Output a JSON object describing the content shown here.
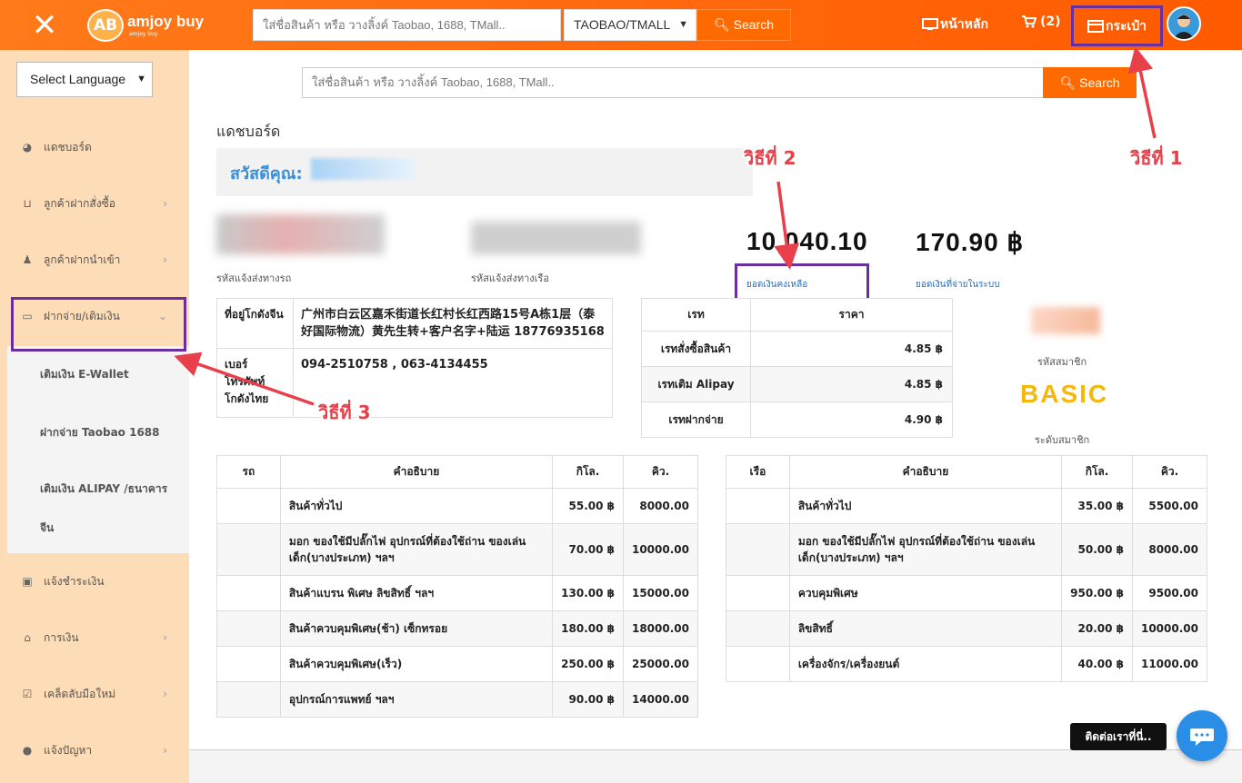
{
  "topbar": {
    "close_icon": "✕",
    "logo_mark": "AB",
    "logo_text": "amjoy buy",
    "logo_sub": "amjoy buy",
    "search_placeholder": "ใส่ชื่อสินค้า หรือ วางลิ้งค์ Taobao, 1688, TMall..",
    "source_select": "TAOBAO/TMALL",
    "search_label": "Search",
    "home_label": "หน้าหลัก",
    "cart_label": "(2)",
    "wallet_label": "กระเป๋า"
  },
  "sidebar": {
    "language_select": "Select Language",
    "items": [
      {
        "label": "แดชบอร์ด",
        "icon": "dashboard-icon"
      },
      {
        "label": "ลูกค้าฝากสั่งซื้อ",
        "icon": "basket-icon"
      },
      {
        "label": "ลูกค้าฝากนำเข้า",
        "icon": "import-icon"
      },
      {
        "label": "ฝากจ่าย/เติมเงิน",
        "icon": "card-icon"
      },
      {
        "label": "แจ้งชำระเงิน",
        "icon": "money-icon"
      },
      {
        "label": "การเงิน",
        "icon": "bank-icon"
      },
      {
        "label": "เคล็ดลับมือใหม่",
        "icon": "check-icon"
      },
      {
        "label": "แจ้งปัญหา",
        "icon": "comment-icon"
      }
    ],
    "submenu": [
      {
        "label": "เติมเงิน E-Wallet"
      },
      {
        "label": "ฝากจ่าย Taobao 1688"
      },
      {
        "label_line1": "เติมเงิน ALIPAY /ธนาคาร",
        "label_line2": "จีน"
      }
    ]
  },
  "main": {
    "search_placeholder": "ใส่ชื่อสินค้า หรือ วางลิ้งค์ Taobao, 1688, TMall..",
    "search_label": "Search",
    "title": "แดชบอร์ด",
    "greeting": "สวัสดีคุณ:",
    "truck_code_label": "รหัสแจ้งส่งทางรถ",
    "ship_code_label": "รหัสแจ้งส่งทางเรือ",
    "balance_value": "10,040.10",
    "balance_label": "ยอดเงินคงเหลือ",
    "paid_value": "170.90 ฿",
    "paid_label": "ยอดเงินที่จ่ายในระบบ",
    "member_code_label": "รหัสสมาชิก",
    "member_level": "BASIC",
    "member_level_label": "ระดับสมาชิก"
  },
  "address": {
    "rows": [
      {
        "key": "ที่อยู่โกดังจีน",
        "value": "广州市白云区嘉禾街道长红村长红西路15号A栋1层（泰好国际物流）黄先生转+客户名字+陆运 18776935168"
      },
      {
        "key": "เบอร์โทรศัพท์โกดังไทย",
        "value": "094-2510758 , 063-4134455"
      }
    ]
  },
  "rates": {
    "headers": [
      "เรท",
      "ราคา"
    ],
    "rows": [
      {
        "name": "เรทสั่งซื้อสินค้า",
        "price": "4.85 ฿"
      },
      {
        "name": "เรทเติม Alipay",
        "price": "4.85 ฿"
      },
      {
        "name": "เรทฝากจ่าย",
        "price": "4.90 ฿"
      }
    ]
  },
  "truck_fees": {
    "headers": [
      "รถ",
      "คำอธิบาย",
      "กิโล.",
      "คิว."
    ],
    "rows": [
      {
        "desc": "สินค้าทั่วไป",
        "kg": "55.00 ฿",
        "cbm": "8000.00"
      },
      {
        "desc": "มอก ของใช้มีปลั๊กไฟ อุปกรณ์ที่ต้องใช้ถ่าน ของเล่นเด็ก(บางประเภท) ฯลฯ",
        "kg": "70.00 ฿",
        "cbm": "10000.00"
      },
      {
        "desc": "สินค้าแบรน พิเศษ ลิขสิทธิ์ ฯลฯ",
        "kg": "130.00 ฿",
        "cbm": "15000.00"
      },
      {
        "desc": "สินค้าควบคุมพิเศษ(ช้า) เซ็กทรอย",
        "kg": "180.00 ฿",
        "cbm": "18000.00"
      },
      {
        "desc": "สินค้าควบคุมพิเศษ(เร็ว)",
        "kg": "250.00 ฿",
        "cbm": "25000.00"
      },
      {
        "desc": "อุปกรณ์การแพทย์ ฯลฯ",
        "kg": "90.00 ฿",
        "cbm": "14000.00"
      }
    ]
  },
  "ship_fees": {
    "headers": [
      "เรือ",
      "คำอธิบาย",
      "กิโล.",
      "คิว."
    ],
    "rows": [
      {
        "desc": "สินค้าทั่วไป",
        "kg": "35.00 ฿",
        "cbm": "5500.00"
      },
      {
        "desc": "มอก ของใช้มีปลั๊กไฟ อุปกรณ์ที่ต้องใช้ถ่าน ของเล่นเด็ก(บางประเภท) ฯลฯ",
        "kg": "50.00 ฿",
        "cbm": "8000.00"
      },
      {
        "desc": "ควบคุมพิเศษ",
        "kg": "950.00 ฿",
        "cbm": "9500.00"
      },
      {
        "desc": "ลิขสิทธิ์",
        "kg": "20.00 ฿",
        "cbm": "10000.00"
      },
      {
        "desc": "เครื่องจักร/เครื่องยนต์",
        "kg": "40.00 ฿",
        "cbm": "11000.00"
      }
    ]
  },
  "annotations": {
    "step1": "วิธีที่ 1",
    "step2": "วิธีที่ 2",
    "step3": "วิธีที่ 3",
    "color": "#e8404a",
    "box_color": "#6a2f9c"
  },
  "contact_label": "ติดต่อเราที่นี่..",
  "colors": {
    "brand_orange": "#ff6a00",
    "sidebar_bg": "#fddcb8",
    "member_gold": "#f5b70a",
    "link_blue": "#2a6fb8"
  }
}
